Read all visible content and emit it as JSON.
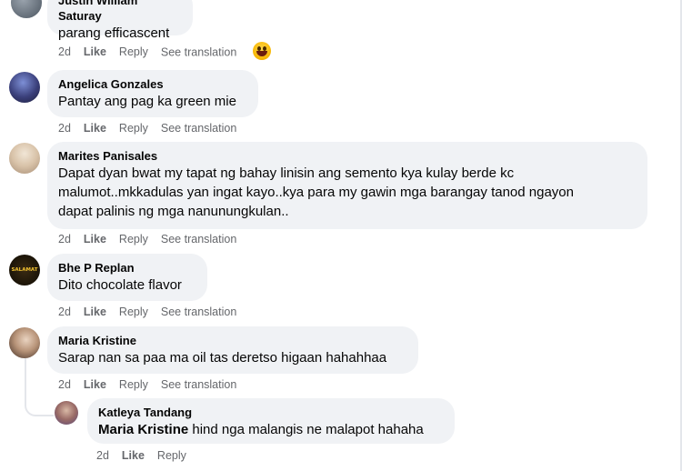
{
  "comments": [
    {
      "author": "Justin William Saturay",
      "text": "parang efficascent",
      "time": "2d",
      "like_label": "Like",
      "reply_label": "Reply",
      "translate_label": "See translation",
      "reaction_icon": "laughing-emoji"
    },
    {
      "author": "Angelica Gonzales",
      "text": "Pantay ang pag ka green mie",
      "time": "2d",
      "like_label": "Like",
      "reply_label": "Reply",
      "translate_label": "See translation"
    },
    {
      "author": "Marites Panisales",
      "text_lines": [
        "Dapat dyan bwat my tapat ng bahay linisin ang semento kya kulay berde kc",
        "malumot..mkkadulas yan ingat kayo..kya para my gawin mga barangay tanod ngayon",
        "dapat palinis ng mga nanunungkulan.."
      ],
      "time": "2d",
      "like_label": "Like",
      "reply_label": "Reply",
      "translate_label": "See translation"
    },
    {
      "author": "Bhe P Replan",
      "text": "Dito chocolate flavor",
      "avatar_text": "SALAMAT",
      "time": "2d",
      "like_label": "Like",
      "reply_label": "Reply",
      "translate_label": "See translation"
    },
    {
      "author": "Maria Kristine",
      "text": "Sarap nan sa paa ma oil tas deretso higaan hahahhaa",
      "time": "2d",
      "like_label": "Like",
      "reply_label": "Reply",
      "translate_label": "See translation"
    }
  ],
  "reply": {
    "author": "Katleya Tandang",
    "mention": "Maria Kristine",
    "text": " hind nga malangis ne malapot hahaha",
    "time": "2d",
    "like_label": "Like",
    "reply_label": "Reply"
  }
}
